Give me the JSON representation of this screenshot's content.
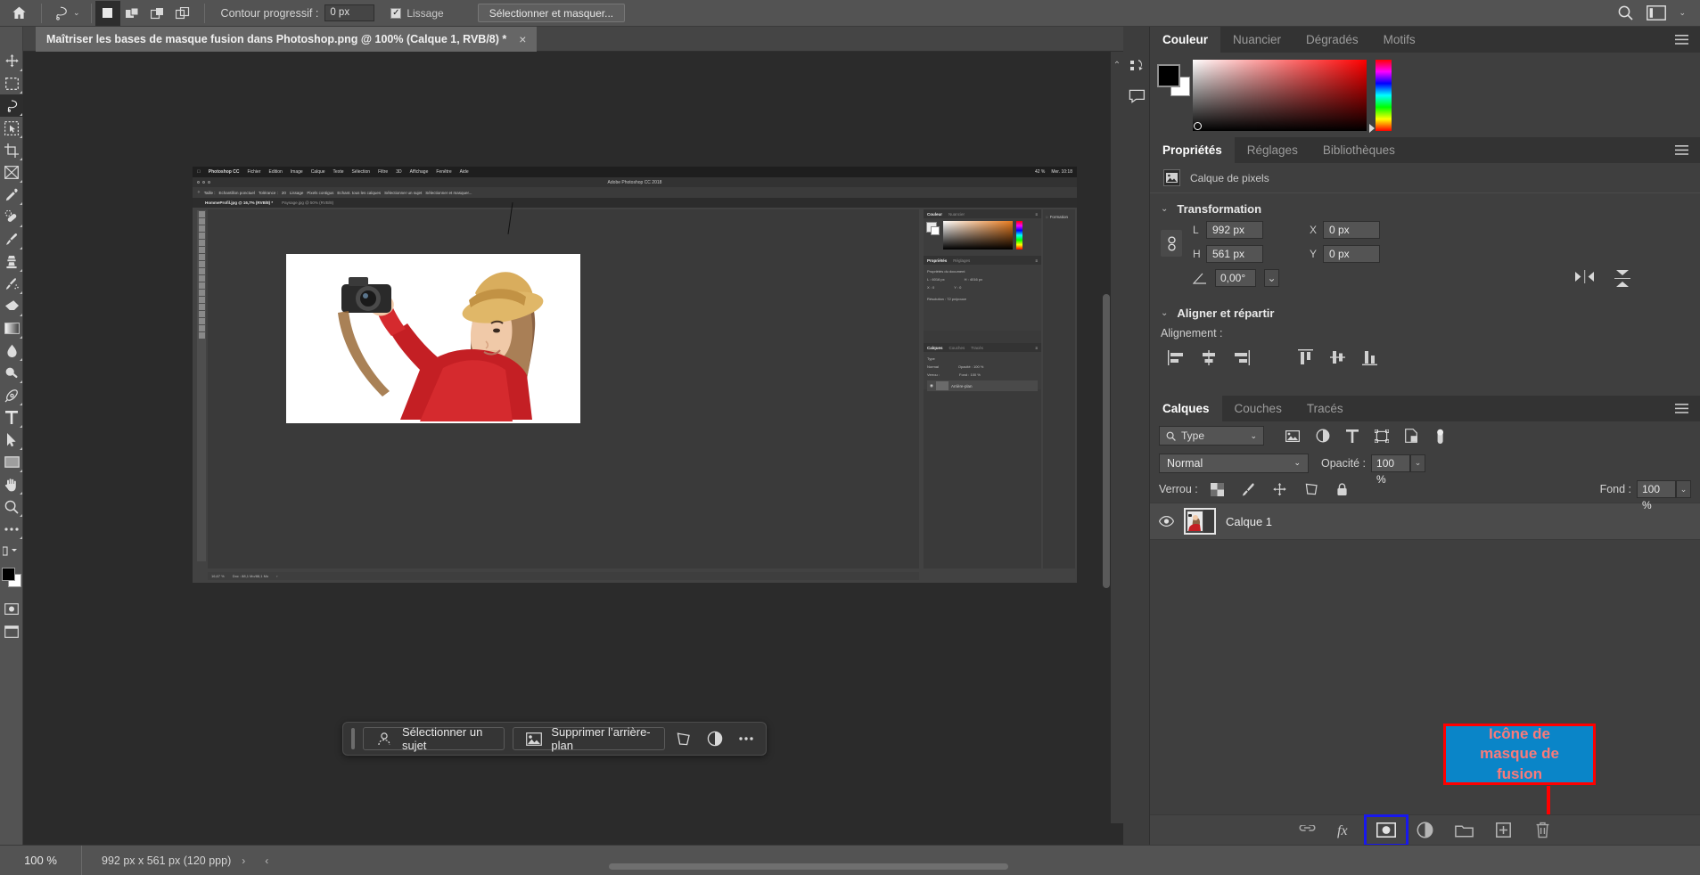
{
  "options_bar": {
    "home_icon": "home-icon",
    "tool_icon": "lasso-tool-icon",
    "selection_modes": [
      "new-selection",
      "add-to-selection",
      "subtract-from-selection",
      "intersect-with-selection"
    ],
    "feather_label": "Contour progressif :",
    "feather_value": "0 px",
    "antialias_label": "Lissage",
    "antialias_checked": true,
    "select_and_mask_button": "Sélectionner et masquer...",
    "right_icons": [
      "search-icon",
      "workspace-icon",
      "chevron-down-icon"
    ]
  },
  "toolbar": {
    "tools": [
      "move-tool",
      "rectangular-marquee-tool",
      "lasso-tool",
      "object-selection-tool",
      "crop-tool",
      "frame-tool",
      "eyedropper-tool",
      "healing-brush-tool",
      "brush-tool",
      "clone-stamp-tool",
      "history-brush-tool",
      "eraser-tool",
      "gradient-tool",
      "blur-tool",
      "dodge-tool",
      "pen-tool",
      "type-tool",
      "path-selection-tool",
      "rectangle-tool",
      "hand-tool",
      "zoom-tool",
      "more-tools",
      "edit-toolbar"
    ],
    "selected_tool": "lasso-tool",
    "foreground_color": "#000000",
    "background_color": "#ffffff"
  },
  "document": {
    "tab_title": "Maîtriser les bases de masque fusion dans Photoshop.png @ 100% (Calque 1, RVB/8) *",
    "close_label": "×"
  },
  "contextual_taskbar": {
    "select_subject": "Sélectionner un sujet",
    "remove_background": "Supprimer l’arrière-plan",
    "transform_icon": "transform-icon",
    "adjustment_icon": "adjustment-layer-icon",
    "more_icon": "more-options-icon"
  },
  "status_bar": {
    "zoom": "100 %",
    "dimensions": "992 px x 561 px (120 ppp)",
    "chevron_right": "›",
    "chevron_left": "‹"
  },
  "color_panel": {
    "tabs": [
      "Couleur",
      "Nuancier",
      "Dégradés",
      "Motifs"
    ],
    "active_tab": "Couleur",
    "foreground": "#000000",
    "background": "#ffffff",
    "hue": "#ff0000"
  },
  "properties_panel": {
    "tabs": [
      "Propriétés",
      "Réglages",
      "Bibliothèques"
    ],
    "active_tab": "Propriétés",
    "layer_kind": "Calque de pixels",
    "layer_kind_icon": "pixel-layer-icon",
    "transformation": {
      "title": "Transformation",
      "width_label": "L",
      "width_value": "992 px",
      "height_label": "H",
      "height_value": "561 px",
      "x_label": "X",
      "x_value": "0 px",
      "y_label": "Y",
      "y_value": "0 px",
      "angle_value": "0,00°",
      "link_icon": "link-aspect-ratio-icon",
      "flip_h_icon": "flip-horizontal-icon",
      "flip_v_icon": "flip-vertical-icon"
    },
    "align": {
      "title": "Aligner et répartir",
      "label": "Alignement :",
      "buttons": [
        "align-left-icon",
        "align-center-h-icon",
        "align-right-icon",
        "align-top-icon",
        "align-center-v-icon",
        "align-bottom-icon"
      ]
    }
  },
  "layers_panel": {
    "tabs": [
      "Calques",
      "Couches",
      "Tracés"
    ],
    "active_tab": "Calques",
    "filter_value": "Type",
    "filter_icons": [
      "filter-pixels-icon",
      "filter-adjustment-icon",
      "filter-type-icon",
      "filter-shape-icon",
      "filter-smart-object-icon",
      "filter-toggle-icon"
    ],
    "blend_mode": "Normal",
    "opacity_label": "Opacité :",
    "opacity_value": "100 %",
    "lock_label": "Verrou :",
    "lock_icons": [
      "lock-transparent-pixels-icon",
      "lock-image-pixels-icon",
      "lock-position-icon",
      "lock-artboard-nesting-icon",
      "lock-all-icon"
    ],
    "fill_label": "Fond :",
    "fill_value": "100 %",
    "layers": [
      {
        "name": "Calque 1",
        "visible": true,
        "eye_icon": "eye-icon"
      }
    ],
    "bottom_icons": [
      "link-layers-icon",
      "layer-style-fx-icon",
      "add-layer-mask-icon",
      "new-fill-adjustment-icon",
      "new-group-icon",
      "new-layer-icon",
      "delete-layer-icon"
    ],
    "highlighted_bottom_icon": "add-layer-mask-icon"
  },
  "annotation": {
    "text_line1": "Icône de",
    "text_line2": "masque de",
    "text_line3": "fusion",
    "box_color": "#0a85c8",
    "border_color": "#ff0000",
    "text_color": "#fa7a7a",
    "arrow_color": "#ff0000"
  },
  "rail": {
    "icons": [
      "history-icon",
      "comment-icon"
    ]
  },
  "canvas_screenshot": {
    "menubar": [
      "Photoshop CC",
      "Fichier",
      "Edition",
      "Image",
      "Calque",
      "Texte",
      "Sélection",
      "Filtre",
      "3D",
      "Affichage",
      "Fenêtre",
      "Aide"
    ],
    "menubar_right": [
      "42 %",
      "Mer. 10:18"
    ],
    "window_title": "Adobe Photoshop CC 2018",
    "options": [
      "Taille :",
      "Echantillon ponctuel",
      "Tolérance :",
      "20",
      "Lissage",
      "Pixels contigus",
      "Echant. tous les calques",
      "Sélectionner un sujet",
      "Sélectionner et masquer..."
    ],
    "tabs": [
      "HommeProfil.jpg @ 16,7% (RVB/8) *",
      "Paysage.jpg @ 50% (RVB/8)"
    ],
    "color_tabs": [
      "Couleur",
      "Nuancier"
    ],
    "prop_tabs": [
      "Propriétés",
      "Réglages"
    ],
    "prop_doc": "Propriétés du document",
    "prop_lines": [
      "L : 6016 px",
      "H : 4016 px",
      "X : 0",
      "Y : 0",
      "Résolution : 72 px/pouce"
    ],
    "layers_tabs": [
      "Calques",
      "Couches",
      "Tracés"
    ],
    "layer_filter": "Type",
    "blend": "Normal",
    "opacity": "Opacité : 100 %",
    "lock": "Verrou :",
    "fill": "Fond : 100 %",
    "layer_name": "Arrière-plan",
    "status": [
      "16,67 %",
      "Doc : 88,1 Mo/88,1 Mo"
    ],
    "side_label": "Formation"
  }
}
